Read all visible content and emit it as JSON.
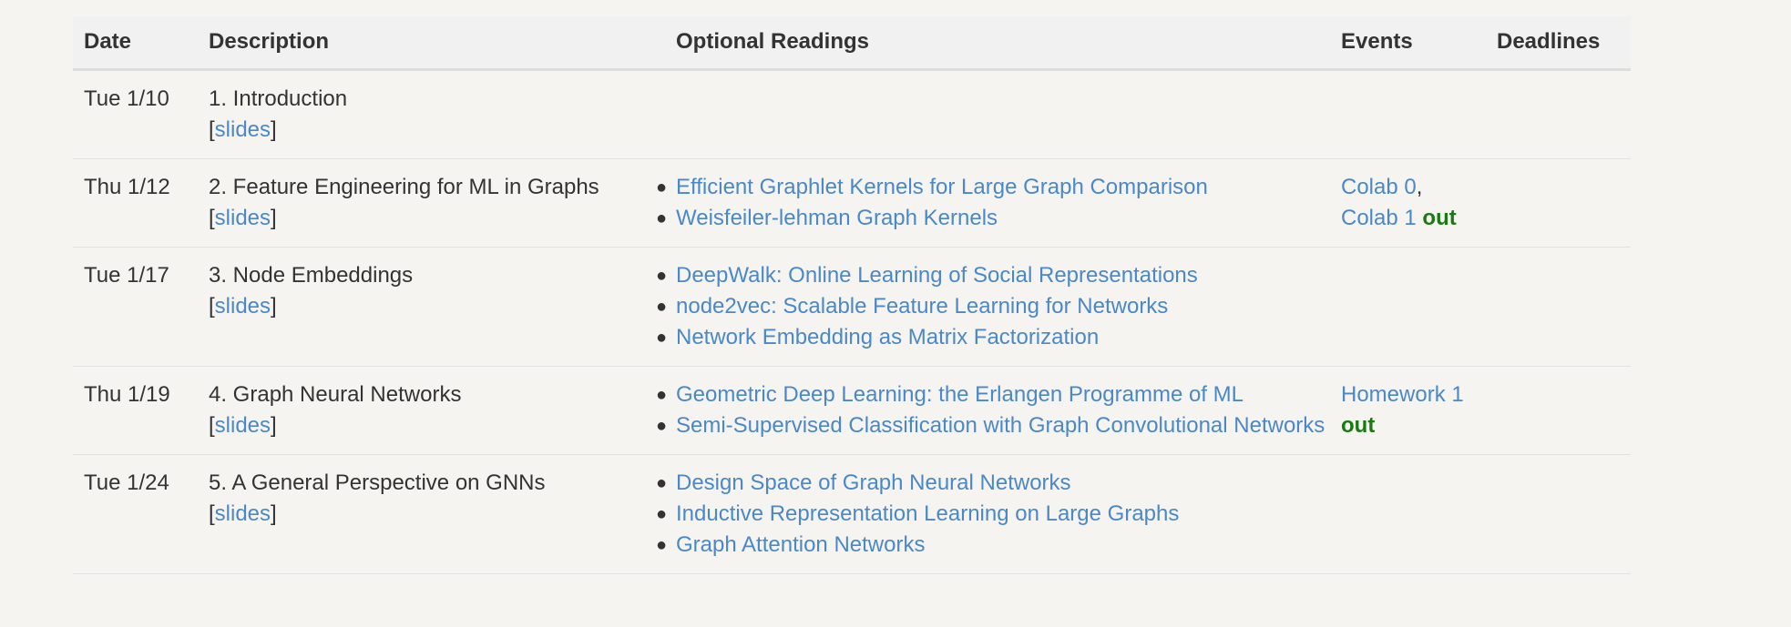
{
  "header": {
    "date": "Date",
    "description": "Description",
    "readings": "Optional Readings",
    "events": "Events",
    "deadlines": "Deadlines"
  },
  "rows": [
    {
      "date": "Tue 1/10",
      "title": "1. Introduction",
      "slides": "slides",
      "readings": [],
      "events": []
    },
    {
      "date": "Thu 1/12",
      "title": "2. Feature Engineering for ML in Graphs",
      "slides": "slides",
      "readings": [
        "Efficient Graphlet Kernels for Large Graph Comparison",
        "Weisfeiler-lehman Graph Kernels"
      ],
      "events": [
        "Colab 0",
        "Colab 1"
      ],
      "events_suffix": "out"
    },
    {
      "date": "Tue 1/17",
      "title": "3. Node Embeddings",
      "slides": "slides",
      "readings": [
        "DeepWalk: Online Learning of Social Representations",
        "node2vec: Scalable Feature Learning for Networks",
        "Network Embedding as Matrix Factorization"
      ],
      "events": []
    },
    {
      "date": "Thu 1/19",
      "title": "4. Graph Neural Networks",
      "slides": "slides",
      "readings": [
        "Geometric Deep Learning: the Erlangen Programme of ML",
        "Semi-Supervised Classification with Graph Convolutional Networks"
      ],
      "events": [
        "Homework 1"
      ],
      "events_suffix": "out"
    },
    {
      "date": "Tue 1/24",
      "title": "5. A General Perspective on GNNs",
      "slides": "slides",
      "readings": [
        "Design Space of Graph Neural Networks",
        "Inductive Representation Learning on Large Graphs",
        "Graph Attention Networks"
      ],
      "events": []
    }
  ],
  "colors": {
    "background": "#f6f4f0",
    "link": "#4a88c7",
    "out": "#1a7a12",
    "header_bg": "#f1f1f1",
    "text": "#333333"
  }
}
